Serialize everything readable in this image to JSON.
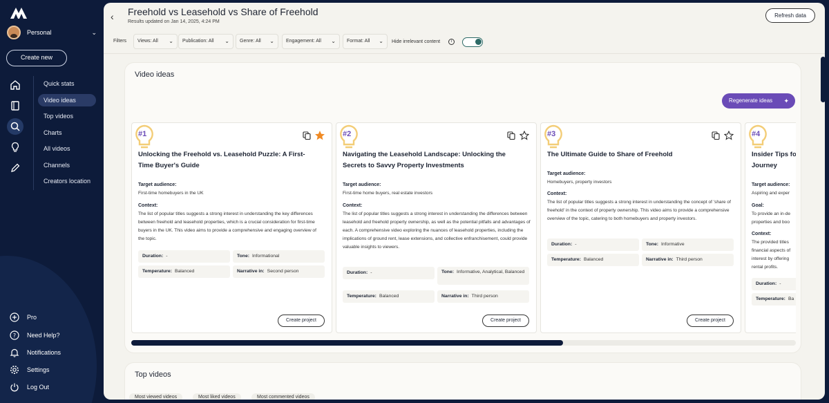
{
  "sidebar": {
    "account_name": "Personal",
    "create_new_label": "Create new",
    "subnav": [
      {
        "label": "Quick stats"
      },
      {
        "label": "Video ideas"
      },
      {
        "label": "Top videos"
      },
      {
        "label": "Charts"
      },
      {
        "label": "All videos"
      },
      {
        "label": "Channels"
      },
      {
        "label": "Creators location"
      }
    ],
    "active_subnav": "Video ideas",
    "bottom": [
      {
        "label": "Pro",
        "icon": "plus-circle-icon"
      },
      {
        "label": "Need Help?",
        "icon": "help-circle-icon"
      },
      {
        "label": "Notifications",
        "icon": "bell-icon"
      },
      {
        "label": "Settings",
        "icon": "gear-icon"
      },
      {
        "label": "Log Out",
        "icon": "power-icon"
      }
    ],
    "rail_icons": [
      "home-icon",
      "book-icon",
      "search-icon",
      "lightbulb-icon",
      "pencil-icon"
    ]
  },
  "header": {
    "title": "Freehold vs Leasehold vs Share of Freehold",
    "updated": "Results updated on Jan 14, 2025, 4:24 PM",
    "refresh_label": "Refresh data"
  },
  "filters": {
    "label": "Filters",
    "items": [
      {
        "label": "Views: All"
      },
      {
        "label": "Publication: All"
      },
      {
        "label": "Genre: All"
      },
      {
        "label": "Engagement: All"
      },
      {
        "label": "Format: All"
      }
    ],
    "hide_label": "Hide irrelevant content",
    "hide_enabled": true
  },
  "video_ideas": {
    "title": "Video ideas",
    "regenerate_label": "Regenerate ideas",
    "cards": [
      {
        "rank": "#1",
        "starred": true,
        "title": "Unlocking the Freehold vs. Leasehold Puzzle: A First-Time Buyer's Guide",
        "target_label": "Target audience:",
        "target": "First-time homebuyers in the UK",
        "context_label": "Context:",
        "context": "The list of popular titles suggests a strong interest in understanding the key differences between freehold and leasehold properties, which is a crucial consideration for first-time buyers in the UK. This video aims to provide a comprehensive and engaging overview of the topic.",
        "duration_label": "Duration:",
        "duration": "-",
        "tone_label": "Tone:",
        "tone": "Informational",
        "temperature_label": "Temperature:",
        "temperature": "Balanced",
        "narrative_label": "Narrative in:",
        "narrative": "Second person",
        "create_label": "Create project"
      },
      {
        "rank": "#2",
        "starred": false,
        "title": "Navigating the Leasehold Landscape: Unlocking the Secrets to Savvy Property Investments",
        "target_label": "Target audience:",
        "target": "First-time home buyers, real estate investors",
        "context_label": "Context:",
        "context": "The list of popular titles suggests a strong interest in understanding the differences between leasehold and freehold property ownership, as well as the potential pitfalls and advantages of each. A comprehensive video exploring the nuances of leasehold properties, including the implications of ground rent, lease extensions, and collective enfranchisement, could provide valuable insights to viewers.",
        "duration_label": "Duration:",
        "duration": "-",
        "tone_label": "Tone:",
        "tone": "Informative, Analytical, Balanced",
        "temperature_label": "Temperature:",
        "temperature": "Balanced",
        "narrative_label": "Narrative in:",
        "narrative": "Third person",
        "create_label": "Create project"
      },
      {
        "rank": "#3",
        "starred": false,
        "title": "The Ultimate Guide to Share of Freehold",
        "target_label": "Target audience:",
        "target": "Homebuyers, property investors",
        "context_label": "Context:",
        "context": "The list of popular titles suggests a strong interest in understanding the concept of 'share of freehold' in the context of property ownership. This video aims to provide a comprehensive overview of the topic, catering to both homebuyers and property investors.",
        "duration_label": "Duration:",
        "duration": "-",
        "tone_label": "Tone:",
        "tone": "Informative",
        "temperature_label": "Temperature:",
        "temperature": "Balanced",
        "narrative_label": "Narrative in:",
        "narrative": "Third person",
        "create_label": "Create project"
      },
      {
        "rank": "#4",
        "title_l1": "Insider Tips fo",
        "title_l2": "Journey",
        "target_label": "Target audience:",
        "target": "Aspiring and exper",
        "goal_label": "Goal:",
        "goal_l1": "To provide an in-de",
        "goal_l2": "properties and boo",
        "context_label": "Context:",
        "context_l1": "The provided titles",
        "context_l2": "financial aspects of",
        "context_l3": "interest by offering",
        "context_l4": "rental profits.",
        "duration_label": "Duration:",
        "duration": "-",
        "temperature_label": "Temperature:",
        "temperature": "Ba"
      }
    ],
    "scroll_fraction": 0.65
  },
  "top_videos": {
    "title": "Top videos",
    "tabs": [
      {
        "label": "Most viewed videos"
      },
      {
        "label": "Most liked videos"
      },
      {
        "label": "Most commented videos"
      }
    ]
  }
}
